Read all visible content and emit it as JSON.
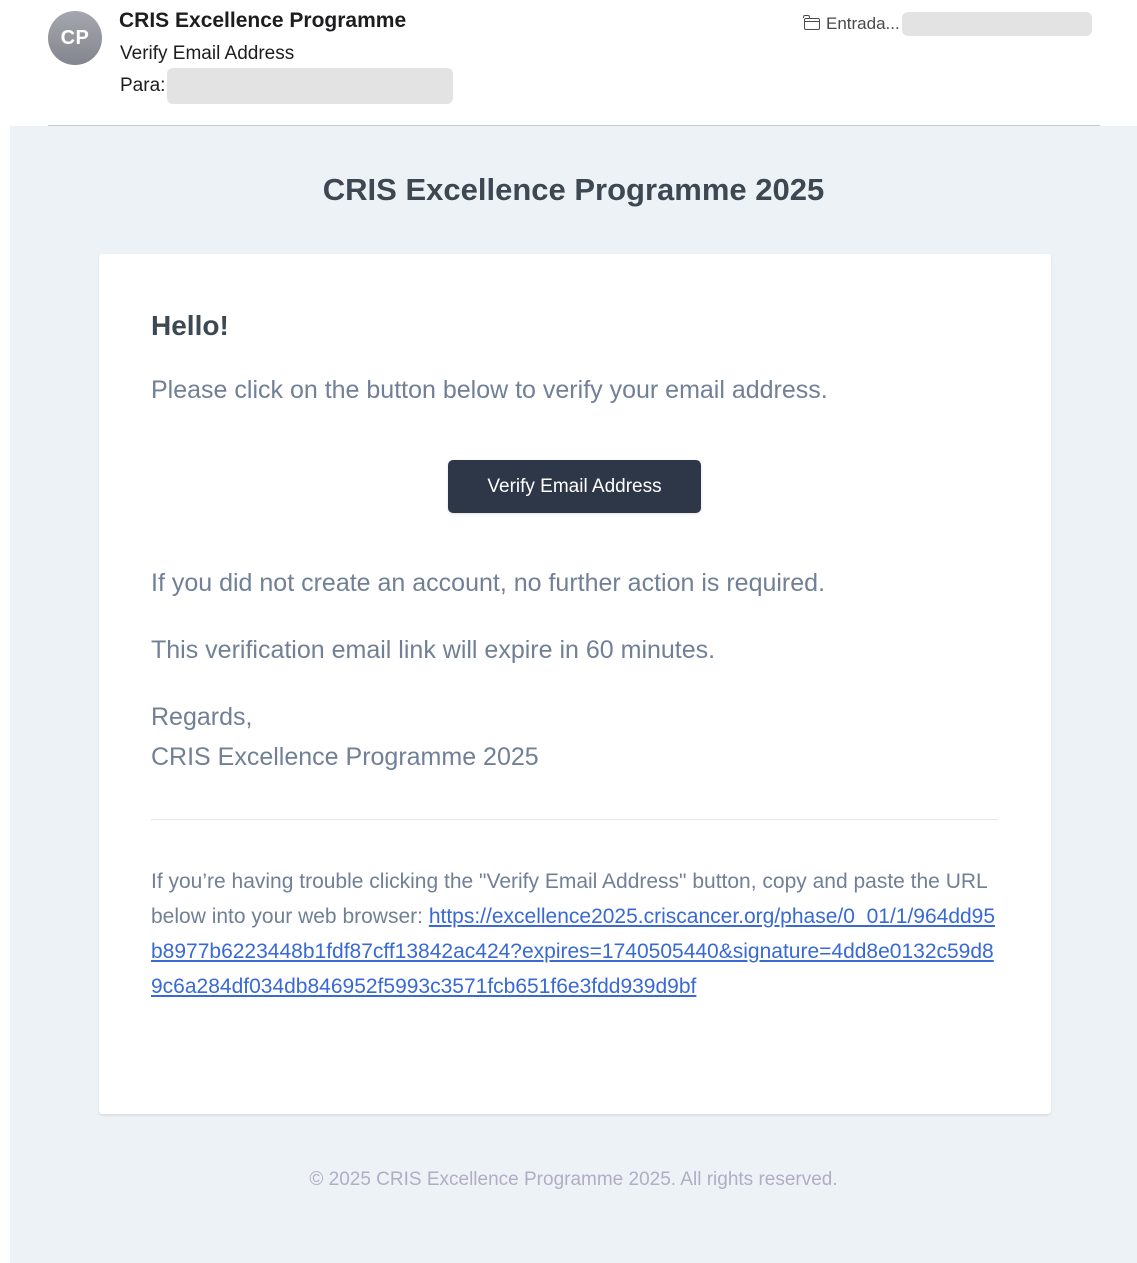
{
  "header": {
    "avatar_initials": "CP",
    "sender_name": "CRIS Excellence Programme",
    "subject": "Verify Email Address",
    "to_label": "Para:",
    "mailbox_label": "Entrada..."
  },
  "email": {
    "title": "CRIS Excellence Programme 2025",
    "greeting": "Hello!",
    "intro": "Please click on the button below to verify your email address.",
    "button_label": "Verify Email Address",
    "no_action": "If you did not create an account, no further action is required.",
    "expiry": "This verification email link will expire in 60 minutes.",
    "regards": "Regards,",
    "signature": "CRIS Excellence Programme 2025",
    "subcopy_text": "If you’re having trouble clicking the \"Verify Email Address\" button, copy and paste the URL below into your web browser: ",
    "subcopy_url": "https://excellence2025.criscancer.org/phase/0_01/1/964dd95b8977b6223448b1fdf87cff13842ac424?expires=1740505440&signature=4dd8e0132c59d89c6a284df034db846952f5993c3571fcb651f6e3fdd939d9bf",
    "footer": "© 2025 CRIS Excellence Programme 2025. All rights reserved."
  },
  "colors": {
    "button_bg": "#2d3748",
    "body_bg": "#edf2f7",
    "link": "#3869d4",
    "text_muted": "#718096",
    "heading": "#3d4852"
  }
}
